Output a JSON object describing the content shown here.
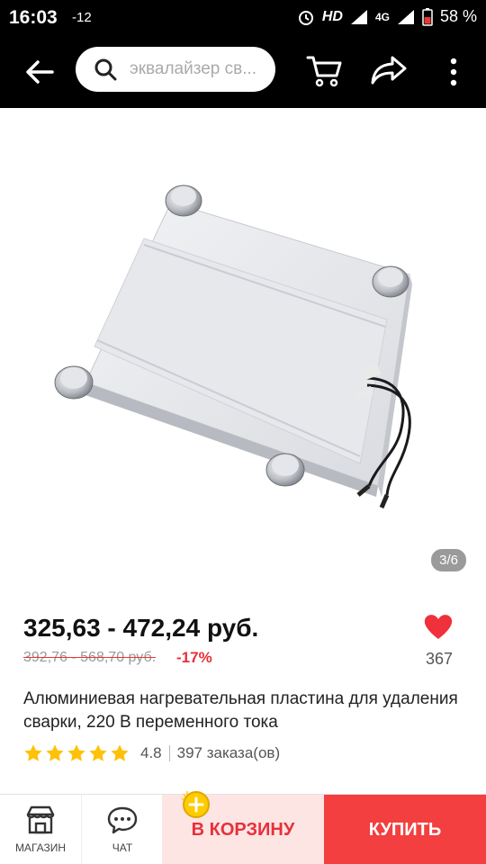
{
  "status_bar": {
    "time": "16:03",
    "notification": "-12",
    "hd": "HD",
    "network": "4G",
    "battery": "58 %"
  },
  "app_bar": {
    "search_placeholder": "эквалайзер св...",
    "icons": [
      "back-arrow-icon",
      "search-icon",
      "cart-icon",
      "share-icon",
      "more-vert-icon"
    ]
  },
  "gallery": {
    "counter": "3/6"
  },
  "product": {
    "price": "325,63 - 472,24 руб.",
    "old_price": "392,76 - 568,70 руб.",
    "discount": "-17%",
    "favorites_count": "367",
    "title": "Алюминиевая нагревательная пластина для удаления сварки, 220 В переменного тока",
    "rating": "4.8",
    "rating_stars": 5,
    "orders": "397 заказа(ов)"
  },
  "bottom_bar": {
    "store_label": "МАГАЗИН",
    "chat_label": "ЧАТ",
    "cart_label": "В КОРЗИНУ",
    "buy_label": "КУПИТЬ"
  },
  "colors": {
    "accent": "#f33f3f",
    "cart_bg": "#fde5e3",
    "discount": "#e8303a",
    "star": "#ffc107",
    "appbar": "#000000"
  }
}
